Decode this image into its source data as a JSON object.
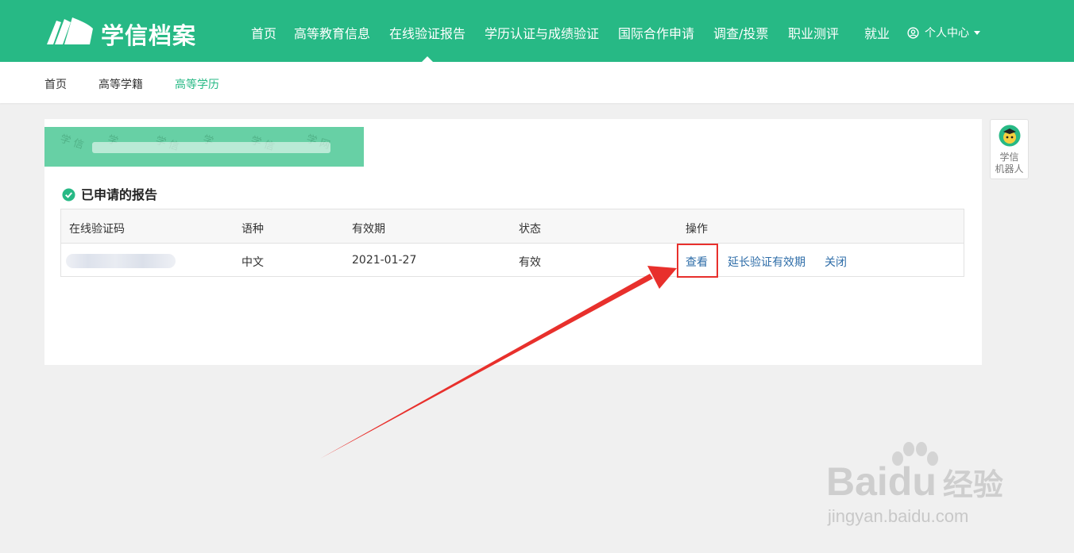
{
  "brand": {
    "name": "学信档案",
    "color": "#27b985"
  },
  "topnav": {
    "items": [
      {
        "label": "首页"
      },
      {
        "label": "高等教育信息"
      },
      {
        "label": "在线验证报告",
        "active": true
      },
      {
        "label": "学历认证与成绩验证"
      },
      {
        "label": "国际合作申请"
      },
      {
        "label": "调查/投票"
      },
      {
        "label": "职业测评"
      },
      {
        "label": "就业"
      }
    ],
    "user_menu": {
      "label": "个人中心",
      "icon": "user-circle-icon"
    }
  },
  "subnav": {
    "items": [
      {
        "label": "首页"
      },
      {
        "label": "高等学籍"
      },
      {
        "label": "高等学历",
        "active": true
      }
    ]
  },
  "section": {
    "title": "已申请的报告",
    "icon": "check-circle-icon"
  },
  "table": {
    "headers": [
      "在线验证码",
      "语种",
      "有效期",
      "状态",
      "操作"
    ],
    "rows": [
      {
        "language": "中文",
        "expiry": "2021-01-27",
        "status": "有效",
        "actions": [
          "查看",
          "延长验证有效期",
          "关闭"
        ]
      }
    ]
  },
  "robot": {
    "label_line1": "学信",
    "label_line2": "机器人"
  },
  "watermark": {
    "logo": "Baidu",
    "logo_cn": "经验",
    "url": "jingyan.baidu.com"
  },
  "colors": {
    "accent": "#27b985",
    "link": "#2e6da8",
    "highlight": "#e8302c"
  }
}
